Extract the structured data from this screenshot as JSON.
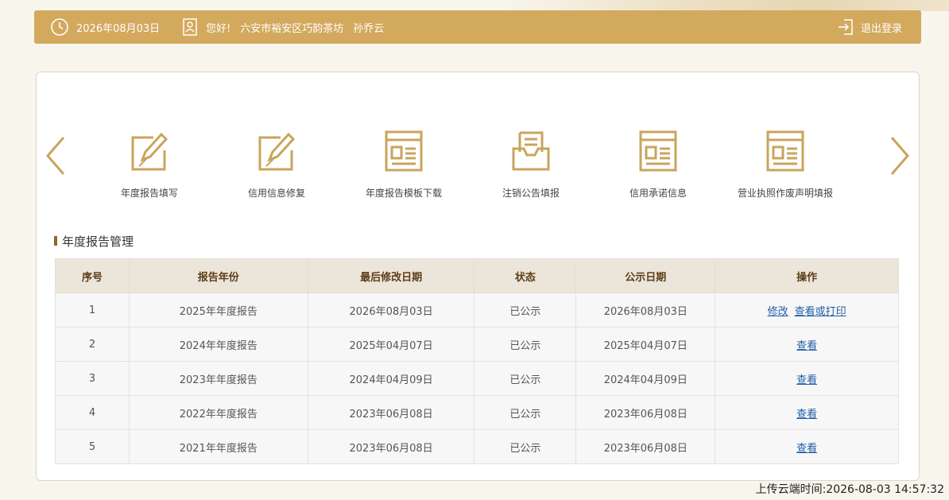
{
  "header": {
    "date": "2026年08月03日",
    "greeting": "您好!",
    "company": "六安市裕安区巧韵茶坊",
    "user": "孙乔云",
    "logout_label": "退出登录"
  },
  "nav": {
    "items": [
      {
        "label": "年度报告填写",
        "icon": "edit-icon"
      },
      {
        "label": "信用信息修复",
        "icon": "edit-icon"
      },
      {
        "label": "年度报告模板下载",
        "icon": "document-icon"
      },
      {
        "label": "注销公告填报",
        "icon": "inbox-icon"
      },
      {
        "label": "信用承诺信息",
        "icon": "document-icon"
      },
      {
        "label": "营业执照作废声明填报",
        "icon": "document-icon"
      }
    ]
  },
  "section": {
    "title": "年度报告管理"
  },
  "table": {
    "headers": [
      "序号",
      "报告年份",
      "最后修改日期",
      "状态",
      "公示日期",
      "操作"
    ],
    "rows": [
      {
        "no": "1",
        "year": "2025年年度报告",
        "modified": "2026年08月03日",
        "status": "已公示",
        "published": "2026年08月03日",
        "actions": [
          "修改",
          "查看或打印"
        ]
      },
      {
        "no": "2",
        "year": "2024年年度报告",
        "modified": "2025年04月07日",
        "status": "已公示",
        "published": "2025年04月07日",
        "actions": [
          "查看"
        ]
      },
      {
        "no": "3",
        "year": "2023年年度报告",
        "modified": "2024年04月09日",
        "status": "已公示",
        "published": "2024年04月09日",
        "actions": [
          "查看"
        ]
      },
      {
        "no": "4",
        "year": "2022年年度报告",
        "modified": "2023年06月08日",
        "status": "已公示",
        "published": "2023年06月08日",
        "actions": [
          "查看"
        ]
      },
      {
        "no": "5",
        "year": "2021年年度报告",
        "modified": "2023年06月08日",
        "status": "已公示",
        "published": "2023年06月08日",
        "actions": [
          "查看"
        ]
      }
    ]
  },
  "footer": {
    "upload_time": "上传云端时间:2026-08-03 14:57:32"
  },
  "colors": {
    "accent": "#d3a95e",
    "icon": "#c9a45c",
    "link": "#1f5fa8"
  }
}
